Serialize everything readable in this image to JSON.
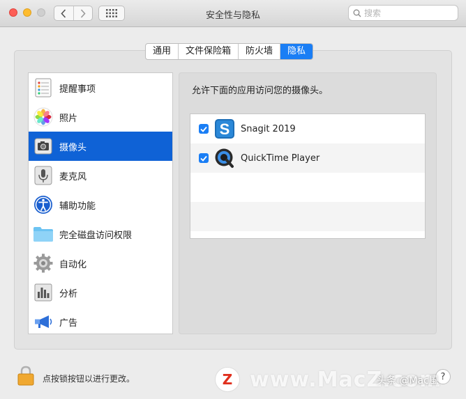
{
  "window": {
    "title": "安全性与隐私",
    "search_placeholder": "搜索"
  },
  "tabs": [
    {
      "label": "通用",
      "active": false
    },
    {
      "label": "文件保险箱",
      "active": false
    },
    {
      "label": "防火墙",
      "active": false
    },
    {
      "label": "隐私",
      "active": true
    }
  ],
  "sidebar": {
    "items": [
      {
        "label": "提醒事项",
        "icon": "reminders-icon"
      },
      {
        "label": "照片",
        "icon": "photos-icon"
      },
      {
        "label": "摄像头",
        "icon": "camera-icon",
        "selected": true
      },
      {
        "label": "麦克风",
        "icon": "microphone-icon"
      },
      {
        "label": "辅助功能",
        "icon": "accessibility-icon"
      },
      {
        "label": "完全磁盘访问权限",
        "icon": "folder-icon"
      },
      {
        "label": "自动化",
        "icon": "gear-icon"
      },
      {
        "label": "分析",
        "icon": "analytics-icon"
      },
      {
        "label": "广告",
        "icon": "megaphone-icon"
      }
    ]
  },
  "main": {
    "instruction": "允许下面的应用访问您的摄像头。",
    "apps": [
      {
        "name": "Snagit 2019",
        "checked": true,
        "icon": "snagit-icon"
      },
      {
        "name": "QuickTime Player",
        "checked": true,
        "icon": "quicktime-icon"
      }
    ]
  },
  "footer": {
    "lock_text": "点按锁按钮以进行更改。",
    "help_label": "?"
  },
  "watermark": {
    "site": "www.MacZ.com",
    "extra": "头条 @Mac風"
  },
  "colors": {
    "accent": "#1a7ef5",
    "selection": "#0f62d6"
  }
}
